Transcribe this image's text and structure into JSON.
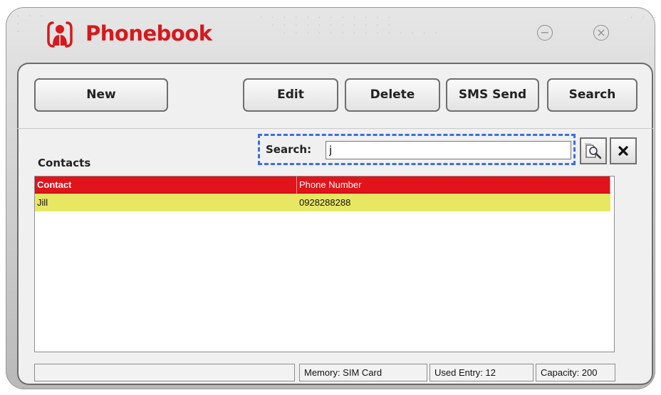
{
  "window": {
    "title": "Phonebook",
    "icons": {
      "app": "person-in-frame-icon",
      "minimize": "minimize-circle-icon",
      "close": "close-circle-icon"
    }
  },
  "toolbar": {
    "new_label": "New",
    "edit_label": "Edit",
    "delete_label": "Delete",
    "sms_label": "SMS Send",
    "search_label": "Search"
  },
  "contacts_label": "Contacts",
  "search": {
    "label": "Search:",
    "value": "j",
    "icons": {
      "find": "magnifier-document-icon",
      "clear": "close-x-icon"
    }
  },
  "table": {
    "headers": [
      "Contact",
      "Phone Number"
    ],
    "rows": [
      {
        "contact": "Jill",
        "phone": "0928288288"
      }
    ]
  },
  "status": {
    "left": "",
    "memory": "Memory: SIM Card",
    "used": "Used Entry: 12",
    "capacity": "Capacity: 200"
  },
  "colors": {
    "title": "#d6191c",
    "header_bg": "#e0141a",
    "selected_row": "#e8e763",
    "focus_dash": "#3a6fe0"
  }
}
